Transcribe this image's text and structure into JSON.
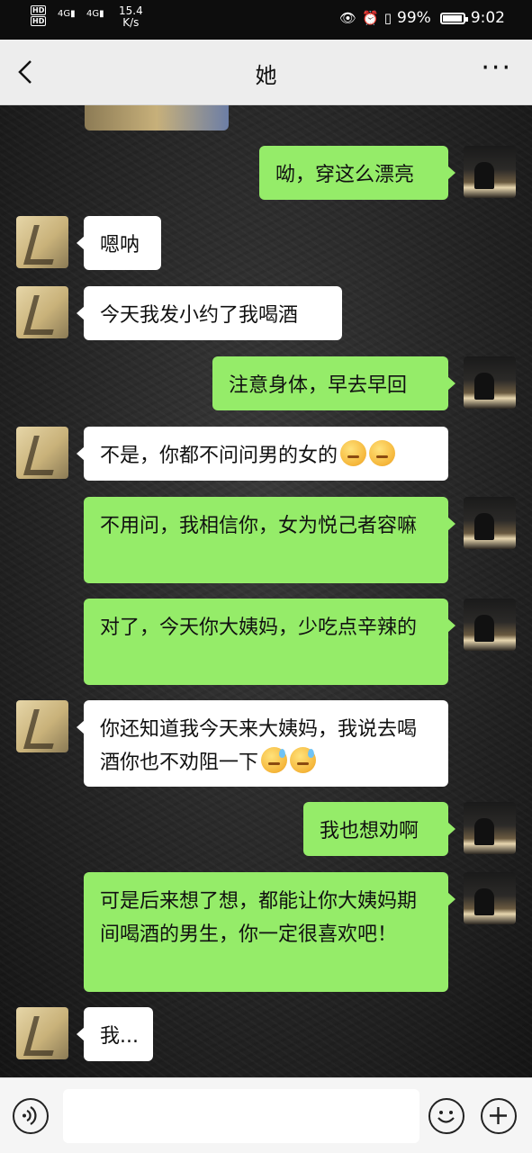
{
  "status_bar": {
    "hd1": "HD",
    "hd2": "HD",
    "net1": "4G",
    "net2": "4G",
    "speed": "15.4",
    "speed_unit": "K/s",
    "battery": "99%",
    "time": "9:02"
  },
  "header": {
    "title": "她"
  },
  "messages": [
    {
      "side": "right",
      "text": "呦，穿这么漂亮"
    },
    {
      "side": "left",
      "text": "嗯呐"
    },
    {
      "side": "left",
      "text": "今天我发小约了我喝酒"
    },
    {
      "side": "right",
      "text": "注意身体，早去早回"
    },
    {
      "side": "left",
      "text": "不是，你都不问问男的女的"
    },
    {
      "side": "right",
      "text": "不用问，我相信你，女为悦己者容嘛"
    },
    {
      "side": "right",
      "text": "对了，今天你大姨妈，少吃点辛辣的"
    },
    {
      "side": "left",
      "text": "你还知道我今天来大姨妈，我说去喝酒你也不劝阻一下"
    },
    {
      "side": "right",
      "text": "我也想劝啊"
    },
    {
      "side": "right",
      "text": "可是后来想了想，都能让你大姨妈期间喝酒的男生，你一定很喜欢吧！"
    },
    {
      "side": "left",
      "text": "我..."
    }
  ],
  "icons": {
    "back": "chevron-left-icon",
    "more": "more-dots-icon",
    "voice": "voice-icon",
    "emoji": "emoji-icon",
    "plus": "plus-icon"
  },
  "colors": {
    "green_bubble": "#95ec69",
    "white_bubble": "#ffffff",
    "header_bg": "#ededed"
  }
}
